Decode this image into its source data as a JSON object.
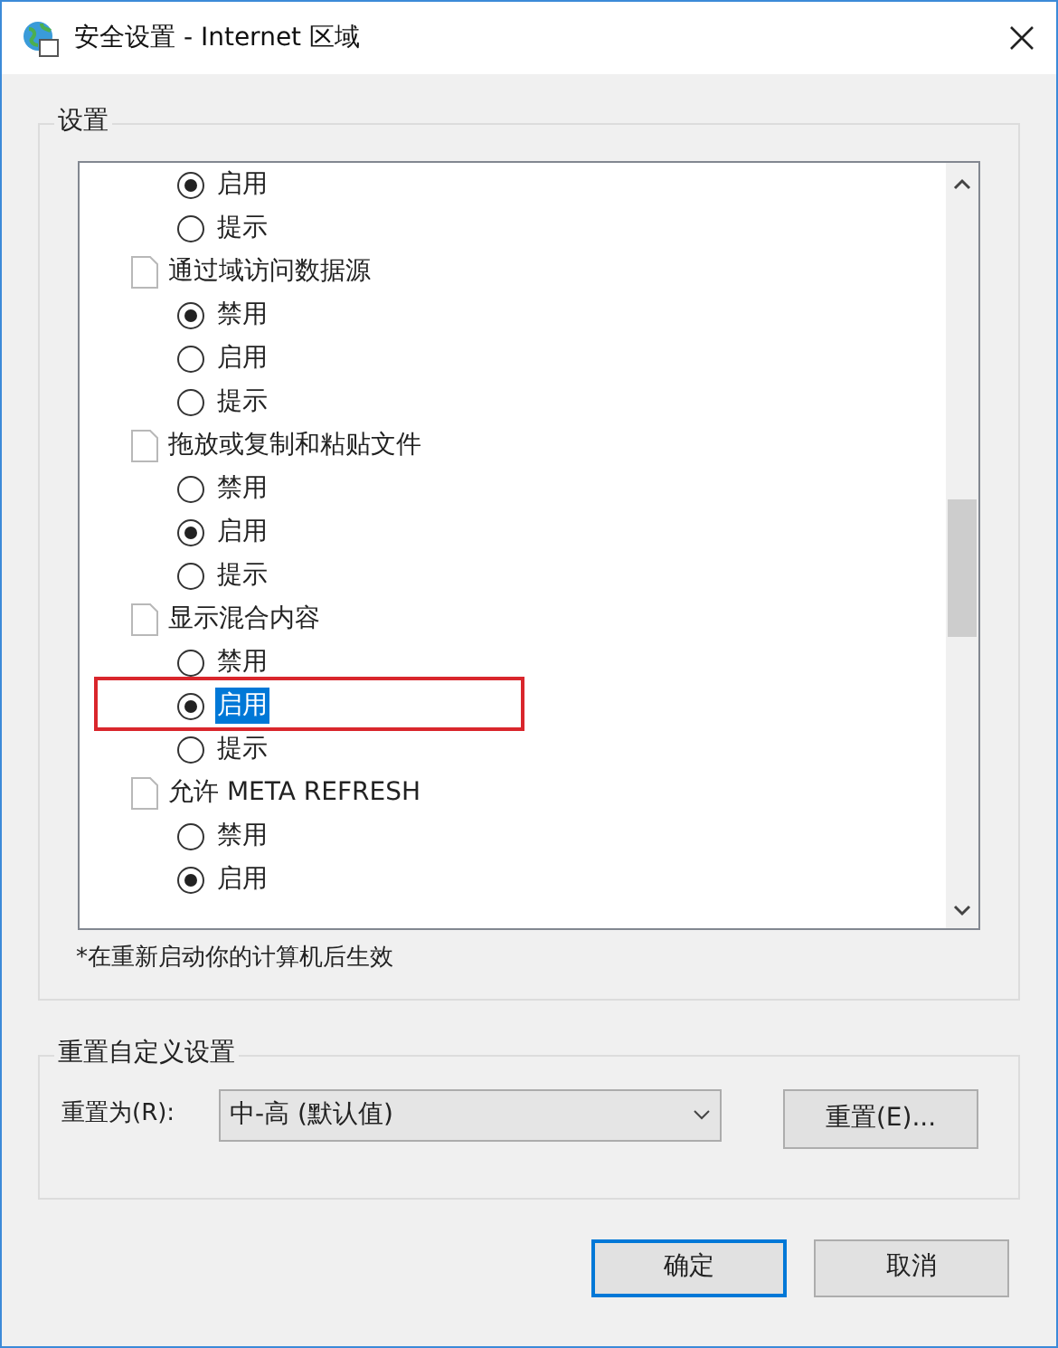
{
  "window": {
    "title": "安全设置 - Internet 区域"
  },
  "settings": {
    "title": "设置",
    "items": [
      {
        "kind": "radio",
        "label": "启用",
        "selected": true,
        "highlighted": false
      },
      {
        "kind": "radio",
        "label": "提示",
        "selected": false,
        "highlighted": false
      },
      {
        "kind": "category",
        "label": "通过域访问数据源",
        "children": [
          {
            "kind": "radio",
            "label": "禁用",
            "selected": true,
            "highlighted": false
          },
          {
            "kind": "radio",
            "label": "启用",
            "selected": false,
            "highlighted": false
          },
          {
            "kind": "radio",
            "label": "提示",
            "selected": false,
            "highlighted": false
          }
        ]
      },
      {
        "kind": "category",
        "label": "拖放或复制和粘贴文件",
        "children": [
          {
            "kind": "radio",
            "label": "禁用",
            "selected": false,
            "highlighted": false
          },
          {
            "kind": "radio",
            "label": "启用",
            "selected": true,
            "highlighted": false
          },
          {
            "kind": "radio",
            "label": "提示",
            "selected": false,
            "highlighted": false
          }
        ]
      },
      {
        "kind": "category",
        "label": "显示混合内容",
        "children": [
          {
            "kind": "radio",
            "label": "禁用",
            "selected": false,
            "highlighted": false
          },
          {
            "kind": "radio",
            "label": "启用",
            "selected": true,
            "highlighted": true
          },
          {
            "kind": "radio",
            "label": "提示",
            "selected": false,
            "highlighted": false
          }
        ]
      },
      {
        "kind": "category",
        "label": "允许 META REFRESH",
        "children": [
          {
            "kind": "radio",
            "label": "禁用",
            "selected": false,
            "highlighted": false
          },
          {
            "kind": "radio",
            "label": "启用",
            "selected": true,
            "highlighted": false
          }
        ]
      }
    ],
    "note": "*在重新启动你的计算机后生效"
  },
  "reset": {
    "title": "重置自定义设置",
    "label": "重置为(R):",
    "value": "中-高 (默认值)",
    "button": "重置(E)..."
  },
  "buttons": [
    {
      "label": "确定",
      "default": true
    },
    {
      "label": "取消",
      "default": false
    }
  ]
}
